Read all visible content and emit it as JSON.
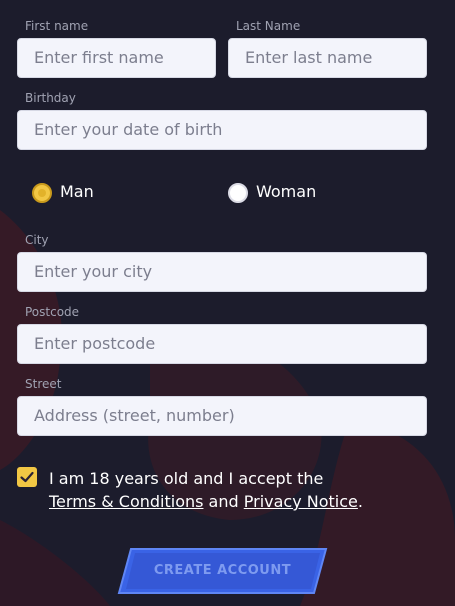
{
  "fields": {
    "first_name": {
      "label": "First name",
      "placeholder": "Enter first name"
    },
    "last_name": {
      "label": "Last Name",
      "placeholder": "Enter last name"
    },
    "birthday": {
      "label": "Birthday",
      "placeholder": "Enter your date of birth"
    },
    "city": {
      "label": "City",
      "placeholder": "Enter your city"
    },
    "postcode": {
      "label": "Postcode",
      "placeholder": "Enter postcode"
    },
    "street": {
      "label": "Street",
      "placeholder": "Address (street, number)"
    }
  },
  "gender": {
    "options": [
      "Man",
      "Woman"
    ],
    "selected": "Man"
  },
  "terms": {
    "prefix": "I am 18 years old and I accept the",
    "terms_link": "Terms & Conditions",
    "and": "and",
    "privacy_link": "Privacy Notice",
    "suffix": ".",
    "checked": true
  },
  "submit": {
    "label": "CREATE ACCOUNT"
  },
  "colors": {
    "background": "#1c1c2c",
    "accent_yellow": "#f2c744",
    "button_blue": "#3a63e6"
  }
}
